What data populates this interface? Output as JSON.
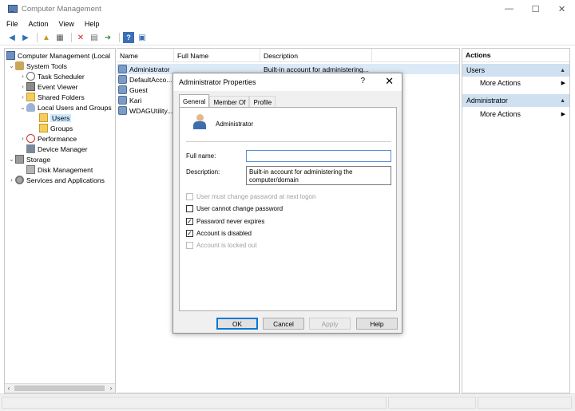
{
  "window": {
    "title": "Computer Management",
    "minimize": "—",
    "maximize": "☐",
    "close": "✕"
  },
  "menu": [
    "File",
    "Action",
    "View",
    "Help"
  ],
  "toolbar": [
    "back-icon",
    "forward-icon",
    "up-icon",
    "show-hide-tree-icon",
    "delete-icon",
    "properties-icon",
    "export-icon",
    "help-icon",
    "view-icon"
  ],
  "tree": [
    {
      "label": "Computer Management (Local",
      "twisty": "",
      "icon": "computer-icon"
    },
    {
      "label": "System Tools",
      "twisty": "⌄",
      "icon": "tools-icon"
    },
    {
      "label": "Task Scheduler",
      "twisty": "›",
      "icon": "clock-icon"
    },
    {
      "label": "Event Viewer",
      "twisty": "›",
      "icon": "event-viewer-icon"
    },
    {
      "label": "Shared Folders",
      "twisty": "›",
      "icon": "shared-folder-icon"
    },
    {
      "label": "Local Users and Groups",
      "twisty": "⌄",
      "icon": "users-icon"
    },
    {
      "label": "Users",
      "twisty": "",
      "icon": "folder-icon"
    },
    {
      "label": "Groups",
      "twisty": "",
      "icon": "folder-icon"
    },
    {
      "label": "Performance",
      "twisty": "›",
      "icon": "performance-icon"
    },
    {
      "label": "Device Manager",
      "twisty": "",
      "icon": "device-manager-icon"
    },
    {
      "label": "Storage",
      "twisty": "⌄",
      "icon": "storage-icon"
    },
    {
      "label": "Disk Management",
      "twisty": "",
      "icon": "disk-icon"
    },
    {
      "label": "Services and Applications",
      "twisty": "›",
      "icon": "services-icon"
    }
  ],
  "list": {
    "columns": [
      "Name",
      "Full Name",
      "Description"
    ],
    "rows": [
      {
        "name": "Administrator",
        "full_name": "",
        "description": "Built-in account for administering..."
      },
      {
        "name": "DefaultAcco...",
        "full_name": "",
        "description": ""
      },
      {
        "name": "Guest",
        "full_name": "",
        "description": ""
      },
      {
        "name": "Kari",
        "full_name": "",
        "description": ""
      },
      {
        "name": "WDAGUtility...",
        "full_name": "",
        "description": ""
      }
    ]
  },
  "actions": {
    "title": "Actions",
    "sections": [
      {
        "header": "Users",
        "item": "More Actions"
      },
      {
        "header": "Administrator",
        "item": "More Actions"
      }
    ]
  },
  "dialog": {
    "title": "Administrator Properties",
    "help": "?",
    "close": "✕",
    "tabs": [
      "General",
      "Member Of",
      "Profile"
    ],
    "user_name": "Administrator",
    "full_name_label": "Full name:",
    "full_name_value": "",
    "description_label": "Description:",
    "description_value": "Built-in account for administering the computer/domain",
    "checkboxes": [
      {
        "label": "User must change password at next logon",
        "checked": false,
        "disabled": true
      },
      {
        "label": "User cannot change password",
        "checked": false,
        "disabled": false
      },
      {
        "label": "Password never expires",
        "checked": true,
        "disabled": false
      },
      {
        "label": "Account is disabled",
        "checked": true,
        "disabled": false
      },
      {
        "label": "Account is locked out",
        "checked": false,
        "disabled": true
      }
    ],
    "buttons": {
      "ok": "OK",
      "cancel": "Cancel",
      "apply": "Apply",
      "help": "Help"
    }
  }
}
